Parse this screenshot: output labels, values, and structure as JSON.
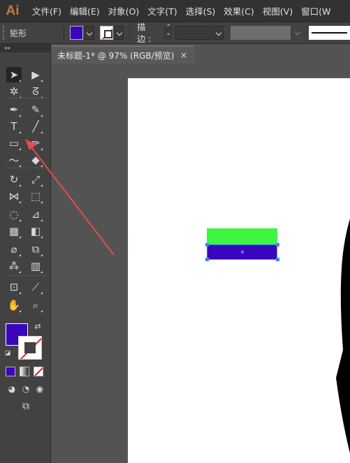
{
  "app": {
    "logo": "Ai"
  },
  "menu": [
    "文件(F)",
    "编辑(E)",
    "对象(O)",
    "文字(T)",
    "选择(S)",
    "效果(C)",
    "视图(V)",
    "窗口(W"
  ],
  "control_bar": {
    "selection_label": "矩形",
    "fill_color": "#3a05bd",
    "stroke_label": "描边",
    "stroke_colon": ":"
  },
  "toolbox": {
    "collapse_glyph": "◂◂",
    "fill_color": "#3a05bd",
    "stroke_color": "none",
    "tools": [
      {
        "name": "selection-tool",
        "glyph": "➤"
      },
      {
        "name": "direct-selection-tool",
        "glyph": "▶"
      },
      {
        "name": "magic-wand-tool",
        "glyph": "✲"
      },
      {
        "name": "lasso-tool",
        "glyph": "ᘔ"
      },
      {
        "name": "pen-tool",
        "glyph": "✒"
      },
      {
        "name": "curvature-tool",
        "glyph": "✎"
      },
      {
        "name": "type-tool",
        "glyph": "T"
      },
      {
        "name": "line-tool",
        "glyph": "╱"
      },
      {
        "name": "rectangle-tool",
        "glyph": "▭"
      },
      {
        "name": "paintbrush-tool",
        "glyph": "✏"
      },
      {
        "name": "shaper-tool",
        "glyph": "〜"
      },
      {
        "name": "eraser-tool",
        "glyph": "◆"
      },
      {
        "name": "rotate-tool",
        "glyph": "↻"
      },
      {
        "name": "scale-tool",
        "glyph": "⤢"
      },
      {
        "name": "width-tool",
        "glyph": "⋈"
      },
      {
        "name": "free-transform-tool",
        "glyph": "⬚"
      },
      {
        "name": "shape-builder-tool",
        "glyph": "◌"
      },
      {
        "name": "perspective-grid-tool",
        "glyph": "⊿"
      },
      {
        "name": "mesh-tool",
        "glyph": "▦"
      },
      {
        "name": "gradient-tool",
        "glyph": "◧"
      },
      {
        "name": "eyedropper-tool",
        "glyph": "⌀"
      },
      {
        "name": "blend-tool",
        "glyph": "⧉"
      },
      {
        "name": "symbol-sprayer-tool",
        "glyph": "⁂"
      },
      {
        "name": "column-graph-tool",
        "glyph": "▥"
      },
      {
        "name": "artboard-tool",
        "glyph": "⊡"
      },
      {
        "name": "slice-tool",
        "glyph": "⟋"
      },
      {
        "name": "hand-tool",
        "glyph": "✋"
      },
      {
        "name": "zoom-tool",
        "glyph": "⌕"
      }
    ]
  },
  "document": {
    "tab_title": "未标题-1* @ 97% (RGB/预览)",
    "close_glyph": "×"
  },
  "canvas": {
    "green_rect_color": "#3ff53f",
    "blue_rect_color": "#3a05bd",
    "selection_color": "#4a7cff",
    "annotation_arrow_color": "#e84b4b"
  }
}
